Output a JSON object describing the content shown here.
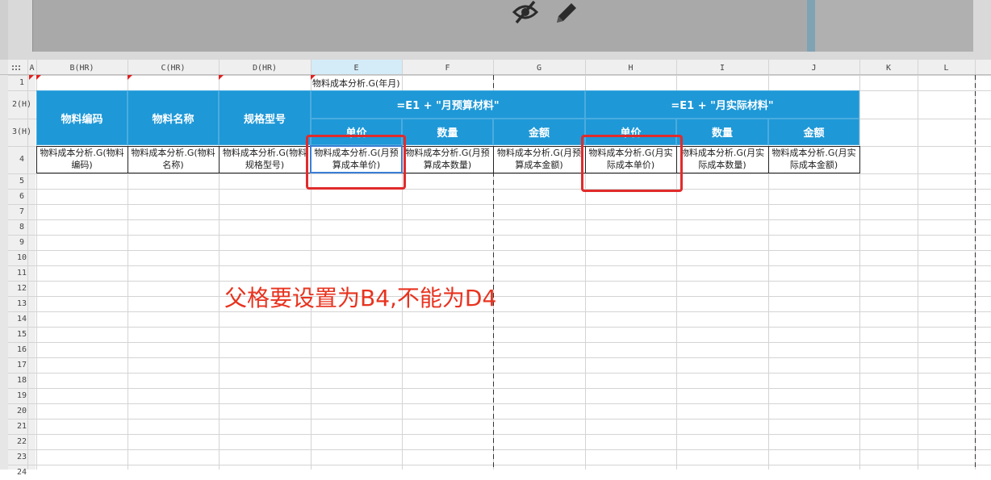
{
  "toolbar": {
    "icons": [
      "eye-off-icon",
      "pencil-icon"
    ]
  },
  "columns": [
    "A",
    "B(HR)",
    "C(HR)",
    "D(HR)",
    "E",
    "F",
    "G",
    "H",
    "I",
    "J",
    "K",
    "L"
  ],
  "rows": [
    "1",
    "2(H)",
    "3(H)",
    "4",
    "5",
    "6",
    "7",
    "8",
    "9",
    "10",
    "11",
    "12",
    "13",
    "14",
    "15",
    "16",
    "17",
    "18",
    "19",
    "20",
    "21",
    "22",
    "23",
    "24"
  ],
  "sheet": {
    "e1_value": "物料成本分析.G(年月)",
    "headers": {
      "material_code": "物料编码",
      "material_name": "物料名称",
      "spec_model": "规格型号",
      "budget_group": "=E1 + \"月预算材料\"",
      "actual_group": "=E1 + \"月实际材料\"",
      "unit_price": "单价",
      "quantity": "数量",
      "amount": "金额"
    },
    "row4": {
      "b": "物料成本分析.G(物料编码)",
      "c": "物料成本分析.G(物料名称)",
      "d": "物料成本分析.G(物料规格型号)",
      "e": "物料成本分析.G(月预算成本单价)",
      "f": "物料成本分析.G(月预算成本数量)",
      "g": "物料成本分析.G(月预算成本金额)",
      "h": "物料成本分析.G(月实际成本单价)",
      "i": "物料成本分析.G(月实际成本数量)",
      "j": "物料成本分析.G(月实际成本金额)"
    }
  },
  "annotation": {
    "text": "父格要设置为B4,不能为D4",
    "color": "#e8331f"
  },
  "colors": {
    "header_blue": "#1e98d7",
    "highlight_red": "#e12b2b",
    "selected_column": "#d4ecf8"
  }
}
